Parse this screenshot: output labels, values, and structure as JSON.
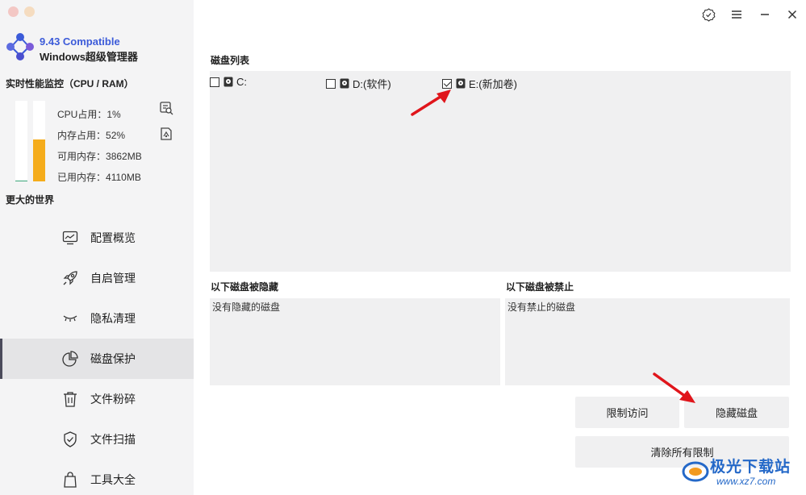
{
  "app": {
    "version": "9.43 Compatible",
    "name": "Windows超级管理器"
  },
  "colors": {
    "accent": "#3c5bd9",
    "cpu_bar": "#3aa57a",
    "ram_bar": "#f5ac1b",
    "arrow": "#e0151b"
  },
  "monitor": {
    "title": "实时性能监控（CPU / RAM）",
    "cpu_percent": 1,
    "ram_percent": 52,
    "stats": [
      {
        "label": "CPU占用：",
        "value": "1%"
      },
      {
        "label": "内存占用：",
        "value": "52%"
      },
      {
        "label": "可用内存：",
        "value": "3862MB"
      },
      {
        "label": "已用内存：",
        "value": "4110MB"
      }
    ],
    "tagline": "更大的世界"
  },
  "nav": [
    {
      "label": "配置概览",
      "icon": "monitor-chart-icon"
    },
    {
      "label": "自启管理",
      "icon": "rocket-icon"
    },
    {
      "label": "隐私清理",
      "icon": "closed-eye-icon"
    },
    {
      "label": "磁盘保护",
      "icon": "pie-chart-icon",
      "active": true
    },
    {
      "label": "文件粉碎",
      "icon": "trash-icon"
    },
    {
      "label": "文件扫描",
      "icon": "shield-check-icon"
    },
    {
      "label": "工具大全",
      "icon": "bag-icon"
    }
  ],
  "main": {
    "disk_list_title": "磁盘列表",
    "disks": [
      {
        "label": "C:",
        "checked": false
      },
      {
        "label": "D:(软件)",
        "checked": false
      },
      {
        "label": "E:(新加卷)",
        "checked": true
      }
    ],
    "hidden_title": "以下磁盘被隐藏",
    "hidden_empty": "没有隐藏的磁盘",
    "disabled_title": "以下磁盘被禁止",
    "disabled_empty": "没有禁止的磁盘",
    "buttons": {
      "restrict": "限制访问",
      "hide": "隐藏磁盘",
      "clear": "清除所有限制"
    }
  },
  "watermark": {
    "text": "极光下载站",
    "url": "www.xz7.com"
  }
}
